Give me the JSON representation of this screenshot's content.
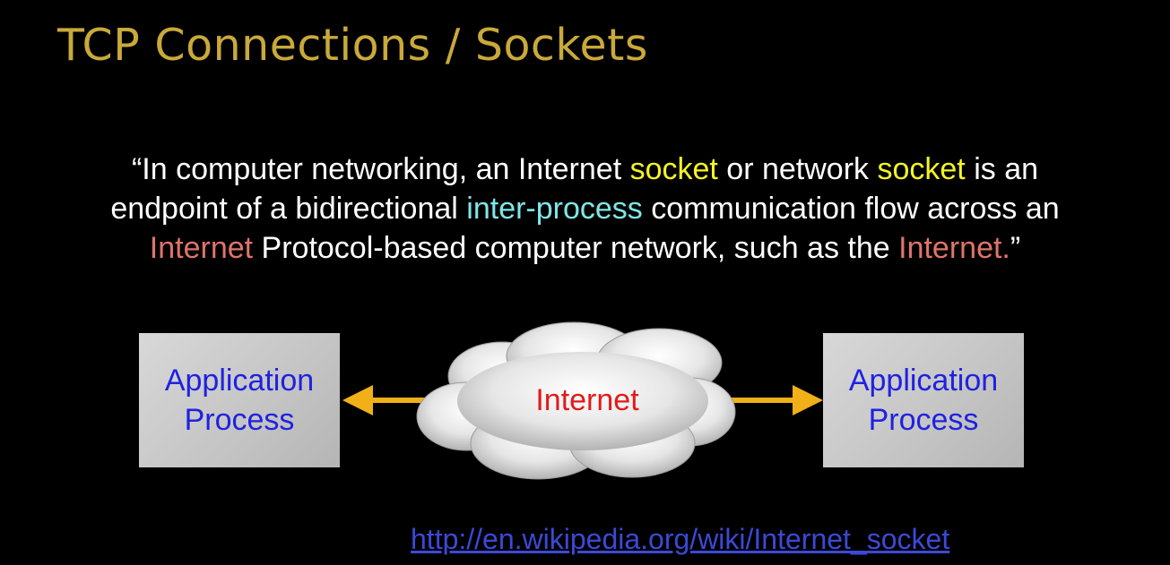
{
  "slide": {
    "title": "TCP Connections / Sockets",
    "quote": {
      "line1": [
        {
          "text": "“In computer networking, an Internet ",
          "style": "plain"
        },
        {
          "text": "socket",
          "style": "yellow"
        },
        {
          "text": " or network ",
          "style": "plain"
        },
        {
          "text": "socket",
          "style": "yellow"
        },
        {
          "text": " is an",
          "style": "plain"
        }
      ],
      "line2": [
        {
          "text": "endpoint of a bidirectional ",
          "style": "plain"
        },
        {
          "text": "inter-process",
          "style": "cyan"
        },
        {
          "text": " communication flow across an",
          "style": "plain"
        }
      ],
      "line3": [
        {
          "text": "Internet",
          "style": "red"
        },
        {
          "text": " Protocol-based computer network, such as the ",
          "style": "plain"
        },
        {
          "text": "Internet.",
          "style": "red"
        },
        {
          "text": "”",
          "style": "plain"
        }
      ]
    },
    "diagram": {
      "left_box": {
        "line1": "Application",
        "line2": "Process"
      },
      "right_box": {
        "line1": "Application",
        "line2": "Process"
      },
      "cloud_label": "Internet",
      "arrow_color": "#f0b018",
      "icons": [
        "cloud-icon",
        "arrow-left-icon",
        "arrow-right-icon"
      ]
    },
    "source_link": "http://en.wikipedia.org/wiki/Internet_socket",
    "colors": {
      "background": "#000000",
      "title": "#c8a93a",
      "highlight_yellow": "#f5f522",
      "highlight_cyan": "#7fe6e6",
      "highlight_red": "#e0746b",
      "box_text": "#1f22e0",
      "cloud_text": "#e11b1b",
      "link": "#3b49d6"
    }
  }
}
